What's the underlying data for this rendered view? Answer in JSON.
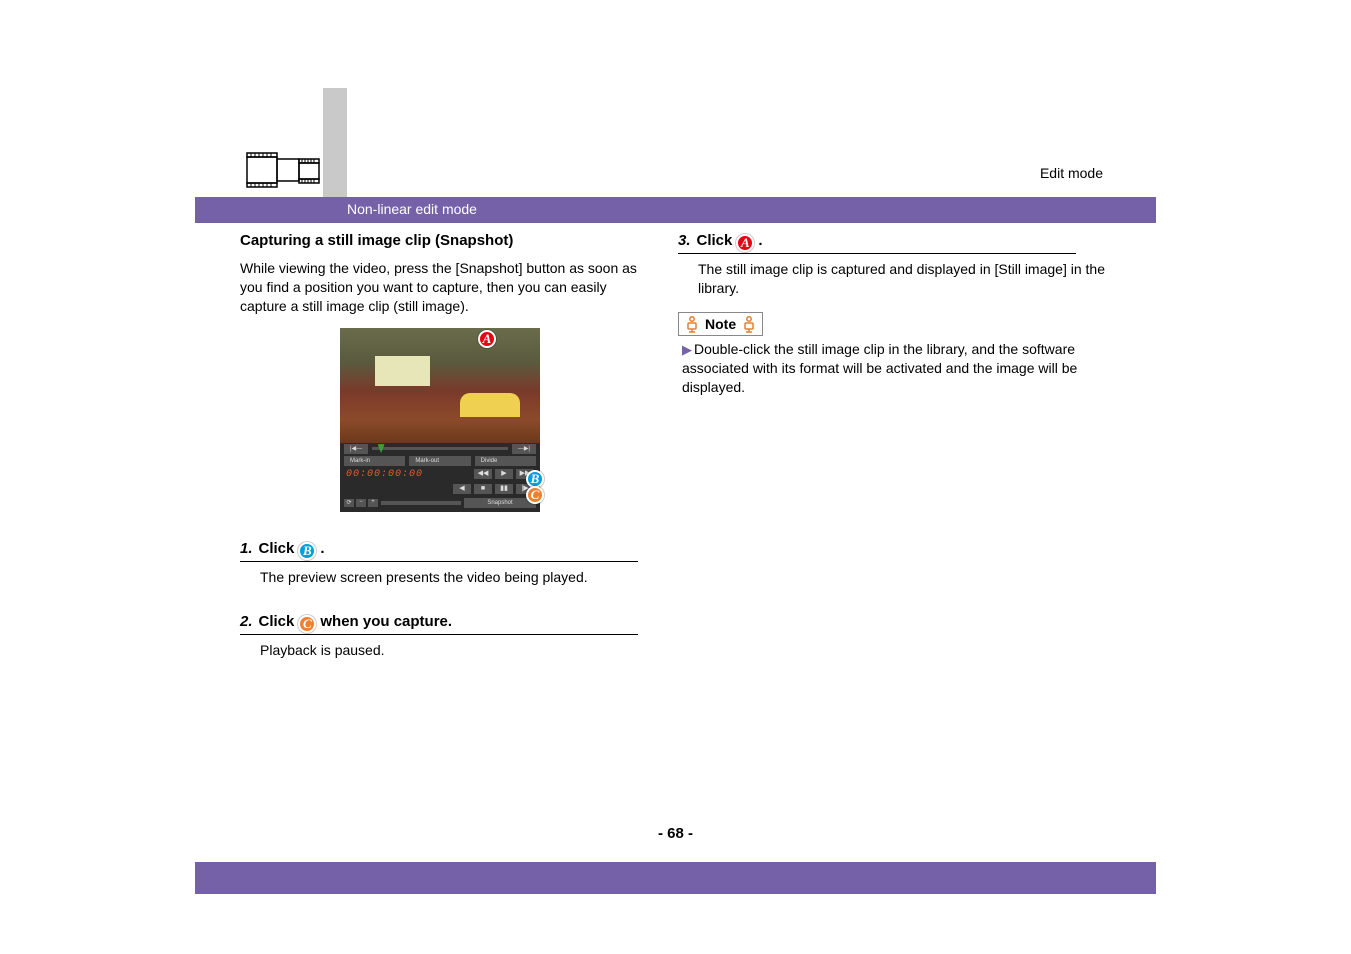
{
  "mode_label": "Edit mode",
  "header_band": "Non-linear edit mode",
  "section_title": "Capturing a still image clip (Snapshot)",
  "intro_text": "While viewing the video, press the [Snapshot] button as soon as you find a position you want to capture, then you can easily capture a still image clip (still image).",
  "preview": {
    "slider_btn_left": "|◀—",
    "slider_btn_right": "—▶|",
    "mark_in": "Mark-in",
    "mark_out": "Mark-out",
    "divide": "Divide",
    "timecode": "00:00:00:00",
    "play_rev": "◀◀",
    "play": "▶",
    "play_fwd": "▶▶",
    "back": "◀",
    "stop": "■",
    "pause": "▮▮",
    "frame": "|▶",
    "zoom_reset": "⟳",
    "zoom_out": "−",
    "zoom_in": "+",
    "snapshot": "Snapshot"
  },
  "markers": {
    "a": "A",
    "b": "B",
    "c": "C"
  },
  "steps": {
    "s1": {
      "num": "1.",
      "label_pre": "Click",
      "label_post": ".",
      "desc": "The preview screen presents the video being played."
    },
    "s2": {
      "num": "2.",
      "label_pre": "Click",
      "label_post": "when you capture.",
      "desc": "Playback is paused."
    },
    "s3": {
      "num": "3.",
      "label_pre": "Click",
      "label_post": ".",
      "desc": "The still image clip is captured and displayed in [Still image] in the library."
    }
  },
  "note": {
    "label": "Note",
    "text": "Double-click the still image clip in the library, and the software associated with its format will be activated and the image will be displayed."
  },
  "page_number": "- 68 -"
}
